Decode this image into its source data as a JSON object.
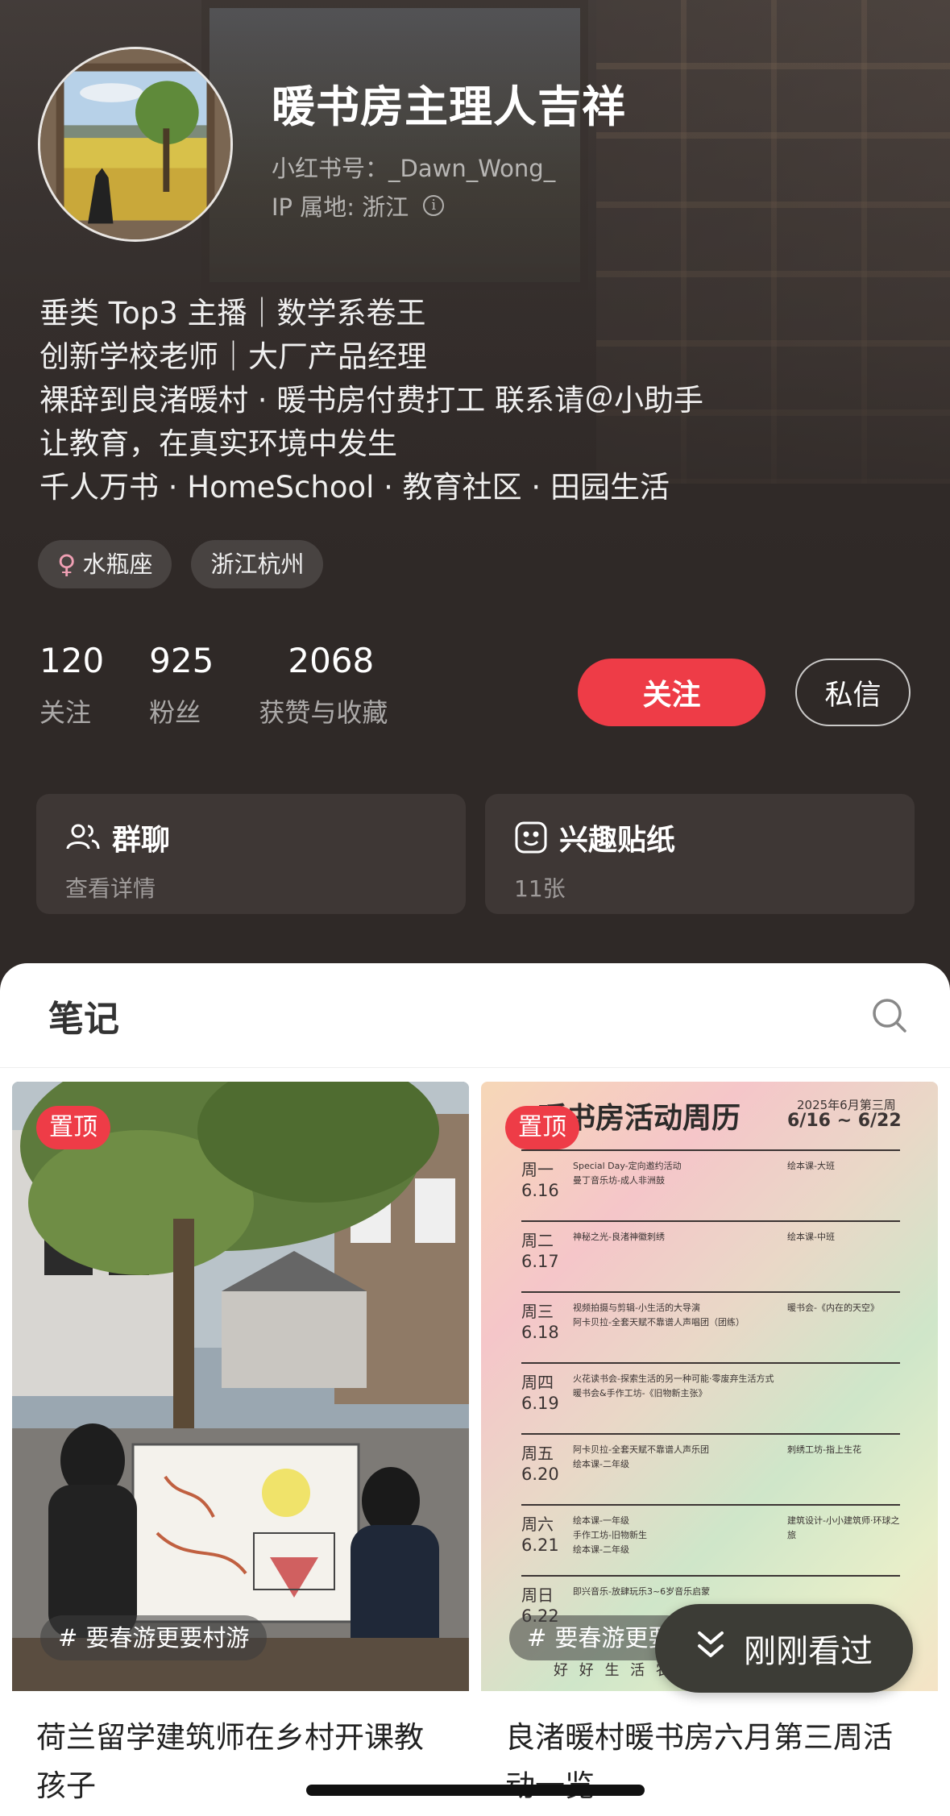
{
  "profile": {
    "name": "暖书房主理人吉祥",
    "red_id": "小红书号：_Dawn_Wong_",
    "ip_location": "IP 属地: 浙江",
    "bio": [
      "垂类 Top3 主播｜数学系卷王",
      "创新学校老师｜大厂产品经理",
      "裸辞到良渚暖村 · 暖书房付费打工 联系请＠小助手",
      "让教育，在真实环境中发生",
      "千人万书 · HomeSchool · 教育社区 · 田园生活"
    ],
    "tags": [
      {
        "label": "水瓶座",
        "icon": "female-icon"
      },
      {
        "label": "浙江杭州"
      }
    ]
  },
  "stats": [
    {
      "value": "120",
      "label": "关注"
    },
    {
      "value": "925",
      "label": "粉丝"
    },
    {
      "value": "2068",
      "label": "获赞与收藏"
    }
  ],
  "actions": {
    "follow": "关注",
    "message": "私信"
  },
  "cards": {
    "group": {
      "title": "群聊",
      "subtitle": "查看详情",
      "icon": "people-icon"
    },
    "stickers": {
      "title": "兴趣贴纸",
      "subtitle": "11张",
      "icon": "sticker-icon"
    }
  },
  "notes_panel": {
    "title": "笔记",
    "notes": [
      {
        "badge": "置顶",
        "topic": "要春游更要村游",
        "title": "荷兰留学建筑师在乡村开课教孩子"
      },
      {
        "badge": "置顶",
        "topic": "要春游更要",
        "title": "良渚暖村暖书房六月第三周活动一览",
        "poster": {
          "heading": "暖书房活动周历",
          "week": "2025年6月第三周",
          "range": "6/16 ~ 6/22",
          "days": [
            {
              "day": "周一",
              "date": "6.16",
              "items": [
                "Special Day-定向邀约活动",
                "曼丁音乐坊-成人非洲鼓"
              ],
              "side": "绘本课-大班"
            },
            {
              "day": "周二",
              "date": "6.17",
              "items": [
                "神秘之光-良渚神徽刺绣"
              ],
              "side": "绘本课-中班"
            },
            {
              "day": "周三",
              "date": "6.18",
              "items": [
                "视频拍摄与剪辑-小生活的大导演",
                "阿卡贝拉-全套天赋不靠谱人声唱团（团练）"
              ],
              "side": "暖书会-《内在的天空》"
            },
            {
              "day": "周四",
              "date": "6.19",
              "items": [
                "火花读书会-探索生活的另一种可能·零废弃生活方式",
                "暖书会&手作工坊-《旧物新主张》"
              ],
              "side": ""
            },
            {
              "day": "周五",
              "date": "6.20",
              "items": [
                "阿卡贝拉-全套天赋不靠谱人声乐团",
                "绘本课-二年级"
              ],
              "side": "刺绣工坊-指上生花"
            },
            {
              "day": "周六",
              "date": "6.21",
              "items": [
                "绘本课-一年级",
                "手作工坊-旧物新生",
                "绘本课-二年级"
              ],
              "side": "建筑设计-小小建筑师·环球之旅"
            },
            {
              "day": "周日",
              "date": "6.22",
              "items": [
                "即兴音乐-放肆玩乐3~6岁音乐启蒙"
              ],
              "side": ""
            }
          ],
          "footer": "好 好 生 活 农 人"
        }
      }
    ]
  },
  "recent_button": "刚刚看过",
  "colors": {
    "accent": "#ee3c47",
    "header_bg": "#2f2927",
    "card_bg": "#3e3735"
  }
}
